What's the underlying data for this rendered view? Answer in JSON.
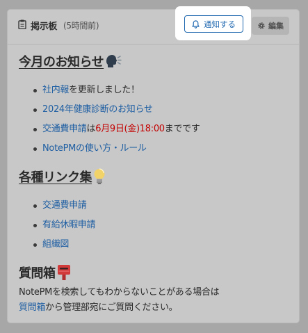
{
  "header": {
    "title": "掲示板",
    "meta": "(5時間前)",
    "notify_label": "通知する",
    "edit_label": "編集"
  },
  "sections": {
    "news": {
      "title": "今月のお知らせ",
      "items": [
        {
          "link": "社内報",
          "rest": "を更新しました！"
        },
        {
          "link": "2024年健康診断のお知らせ"
        },
        {
          "link": "交通費申請",
          "mid": "は",
          "red": "6月9日(金)18:00",
          "rest": "までです"
        },
        {
          "link": "NotePMの使い方・ルール"
        }
      ]
    },
    "links": {
      "title": "各種リンク集",
      "items": [
        "交通費申請",
        "有給休暇申請",
        "組織図"
      ]
    },
    "qa": {
      "title": "質問箱",
      "line1": "NotePMを検索してもわからないことがある場合は",
      "line2_link": "質問箱",
      "line2_rest": "から管理部宛にご質問ください。"
    }
  },
  "colors": {
    "link": "#1f5fa3",
    "accent": "#1f68b0",
    "highlight": "#c40000"
  }
}
